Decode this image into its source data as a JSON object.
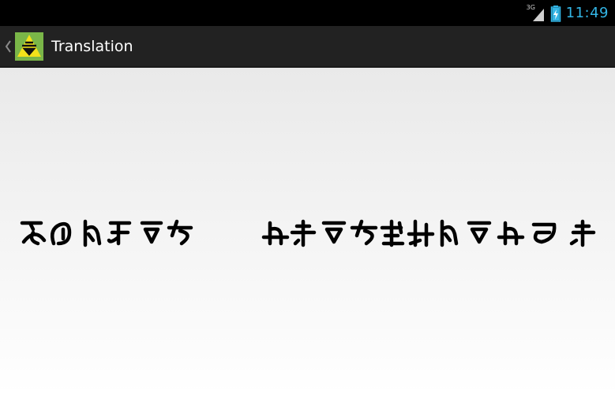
{
  "status_bar": {
    "network_type": "3G",
    "time": "11:49",
    "icons": [
      "signal-icon",
      "battery-charging-icon"
    ]
  },
  "action_bar": {
    "title": "Translation",
    "icons": [
      "back-chevron-icon",
      "app-icon"
    ]
  },
  "translation": {
    "words": [
      {
        "glyph_count": 6
      },
      {
        "glyph_count": 12
      }
    ]
  },
  "colors": {
    "status_bar_bg": "#000000",
    "action_bar_bg": "#222222",
    "clock": "#33b5e5",
    "app_icon_bg": "#7ab648",
    "app_icon_triangle": "#f3e21a",
    "glyph": "#000000",
    "content_top": "#e9e9e9",
    "content_bottom": "#ffffff"
  }
}
